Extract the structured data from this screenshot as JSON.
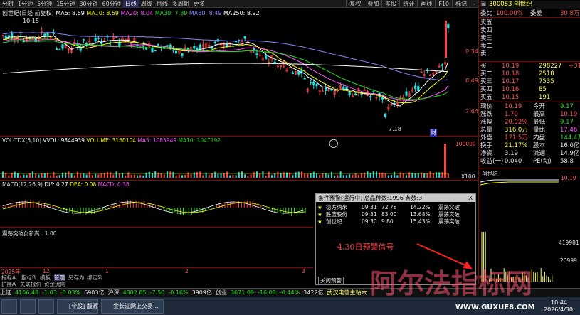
{
  "toolbar": {
    "periods": [
      "分时",
      "1分钟",
      "5分钟",
      "15分钟",
      "30分钟",
      "60分钟",
      "日线",
      "周线",
      "月线",
      "多周期",
      "更多"
    ],
    "active_period": "日线",
    "right_buttons": [
      "复权",
      "叠加",
      "多股",
      "统计",
      "画线",
      "F10",
      "标记",
      "-"
    ]
  },
  "main_chart": {
    "title": "创世纪(日线 前复权)",
    "ma_labels": [
      {
        "text": "MA5: 8.69",
        "color": "#ffffff"
      },
      {
        "text": "MA10: 8.59",
        "color": "#ffff00"
      },
      {
        "text": "MA20: 8.04",
        "color": "#ff55ff"
      },
      {
        "text": "MA30: 7.89",
        "color": "#22dd22"
      },
      {
        "text": "MA60: 8.49",
        "color": "#8888ff"
      },
      {
        "text": "MA250: 8.92",
        "color": "#ffffff"
      }
    ],
    "price_labels": [
      "9.34",
      "8.49",
      "7.64"
    ],
    "high_label": "10.15",
    "low_label": "7.18",
    "marker": "财"
  },
  "volume_panel": {
    "title": "VOL-TDX(5,10)",
    "values": [
      {
        "text": "VVOL: 9844939",
        "color": "#ffffff"
      },
      {
        "text": "VOLUME: 3160104",
        "color": "#ffff00"
      },
      {
        "text": "MA5: 1085949",
        "color": "#ff55ff"
      },
      {
        "text": "MA10: 1047192",
        "color": "#22dd22"
      }
    ],
    "axis": [
      "100000",
      "X100"
    ]
  },
  "macd_panel": {
    "title": "MACD(12,26,9)",
    "values": [
      {
        "text": "DIF: 0.27",
        "color": "#ffffff"
      },
      {
        "text": "DEA: 0.08",
        "color": "#ffff00"
      },
      {
        "text": "MACD: 0.38",
        "color": "#ff55ff"
      }
    ]
  },
  "signal_panel": {
    "title": "震荡突破创新高 : 1.00"
  },
  "date_axis": [
    "2025年",
    "12",
    "1",
    "2",
    "3",
    "4"
  ],
  "bottom_tabs": [
    "指标A",
    "指标B",
    "模板",
    "管理",
    "另存为",
    "绑定到"
  ],
  "bottom_tabs2": [
    "扩展A",
    "关联报价",
    "资金流向"
  ],
  "dialog": {
    "title": "条件预警[运行中] 总品种数:1996 条数:3",
    "rows": [
      {
        "name": "德方纳米",
        "time": "09:31",
        "price": "72.78",
        "pct": "14.22%",
        "type": "震荡突破"
      },
      {
        "name": "胜蓝股份",
        "time": "09:31",
        "price": "83.00",
        "pct": "13.68%",
        "type": "震荡突破"
      },
      {
        "name": "创世纪",
        "time": "09:30",
        "price": "9.80",
        "pct": "15.43%",
        "type": "震荡突破"
      }
    ],
    "note": "4.30日预警信号",
    "close_button": "关闭预警",
    "close_x": "X"
  },
  "quote": {
    "code_name": "300083 创世纪",
    "commission": {
      "label1": "委比",
      "v1": "100.00%",
      "label2": "委差",
      "v2": "30.8万"
    },
    "sells": [
      {
        "label": "卖五"
      },
      {
        "label": "卖四"
      },
      {
        "label": "卖三"
      },
      {
        "label": "卖二"
      },
      {
        "label": "卖一"
      }
    ],
    "buys": [
      {
        "label": "买一",
        "price": "10.19",
        "vol": "298227",
        "chg": "+31"
      },
      {
        "label": "买二",
        "price": "10.18",
        "vol": "2518",
        "chg": ""
      },
      {
        "label": "买三",
        "price": "10.17",
        "vol": "7535",
        "chg": ""
      },
      {
        "label": "买四",
        "price": "10.16",
        "vol": "85",
        "chg": ""
      },
      {
        "label": "买五",
        "price": "10.15",
        "vol": "191",
        "chg": ""
      }
    ],
    "stats": [
      {
        "l1": "现价",
        "v1": "10.19",
        "l2": "今开",
        "v2": "9.17",
        "c1": "#ff5555",
        "c2": "#22dd22"
      },
      {
        "l1": "涨跌",
        "v1": "1.70",
        "l2": "最高",
        "v2": "10.19",
        "c1": "#ff5555",
        "c2": "#ff5555"
      },
      {
        "l1": "涨幅",
        "v1": "20.02%",
        "l2": "最低",
        "v2": "9.17",
        "c1": "#ff5555",
        "c2": "#22dd22"
      },
      {
        "l1": "总量",
        "v1": "316.0万",
        "l2": "量比",
        "v2": "17.46",
        "c1": "#ffff55",
        "c2": "#ff55ff"
      },
      {
        "l1": "外盘",
        "v1": "171.5万",
        "l2": "内盘",
        "v2": "144.4万",
        "c1": "#ff5555",
        "c2": "#22dd22"
      },
      {
        "l1": "换手",
        "v1": "21.17%",
        "l2": "股本",
        "v2": "16.6亿",
        "c1": "#ffff55",
        "c2": "#e0e0e0"
      },
      {
        "l1": "净资",
        "v1": "3.19",
        "l2": "流通",
        "v2": "14.9亿",
        "c1": "#e0e0e0",
        "c2": "#e0e0e0"
      },
      {
        "l1": "收益(一)",
        "v1": "0.040",
        "l2": "PE(动)",
        "v2": "58.8",
        "c1": "#e0e0e0",
        "c2": "#e0e0e0"
      }
    ],
    "mini_chart_title": "创世纪",
    "mini_labels": [
      "10.19",
      "419981",
      "20999"
    ]
  },
  "status": {
    "items": [
      {
        "text": "上证",
        "color": "#e0e0e0"
      },
      {
        "text": "4106.48",
        "color": "#22dd22"
      },
      {
        "text": "-1.03",
        "color": "#22dd22"
      },
      {
        "text": "-0.03%",
        "color": "#22dd22"
      },
      {
        "text": "6903亿",
        "color": "#e0e0e0"
      },
      {
        "text": "沪深",
        "color": "#e0e0e0"
      },
      {
        "text": "4802.85",
        "color": "#22dd22"
      },
      {
        "text": "-7.50",
        "color": "#22dd22"
      },
      {
        "text": "-0.16%",
        "color": "#22dd22"
      },
      {
        "text": "3909亿",
        "color": "#e0e0e0"
      },
      {
        "text": "创业",
        "color": "#e0e0e0"
      },
      {
        "text": "3671.09",
        "color": "#22dd22"
      },
      {
        "text": "-16.08",
        "color": "#22dd22"
      },
      {
        "text": "-0.44%",
        "color": "#22dd22"
      },
      {
        "text": "3422亿",
        "color": "#e0e0e0"
      },
      {
        "text": "武汉电信主站六",
        "color": "#ffff55"
      }
    ]
  },
  "taskbar": {
    "tasks": [
      "[个股] 服源被...",
      "金长江网上交易..."
    ],
    "watermark": "阿尔法指标网",
    "watermark_url": "WWW.GUXUE8.COM",
    "clock_time": "10:44",
    "clock_date": "2026/4/30"
  }
}
